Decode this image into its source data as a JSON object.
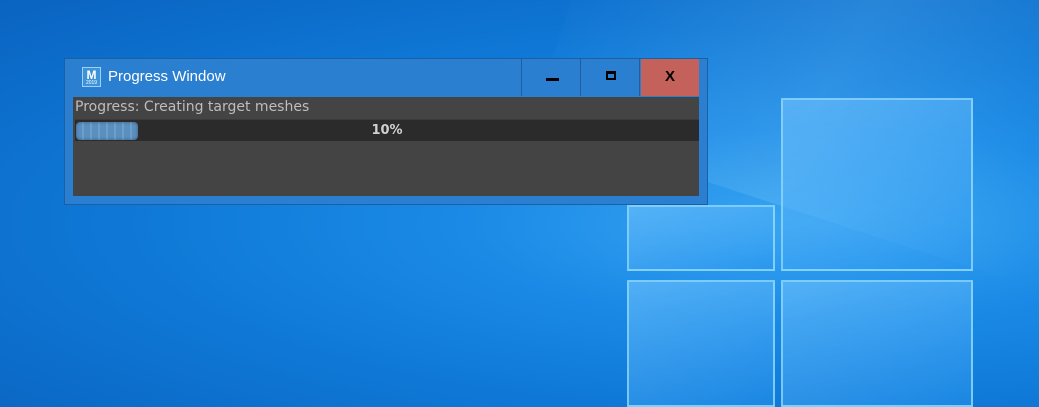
{
  "window": {
    "title": "Progress Window",
    "app_icon": {
      "name": "maya-app-icon",
      "letter": "M",
      "sub": "2019"
    },
    "controls": {
      "minimize_icon": "minimize-icon",
      "maximize_icon": "maximize-icon",
      "close_label": "X"
    }
  },
  "progress": {
    "label": "Progress: Creating target meshes",
    "value": 0.1,
    "percent_text": "10%",
    "fill_color": "#5b8fbf"
  },
  "colors": {
    "titlebar": "#2b7fd1",
    "close_button": "#c4615a",
    "content_bg": "#444444",
    "track_bg": "#2b2b2b"
  }
}
